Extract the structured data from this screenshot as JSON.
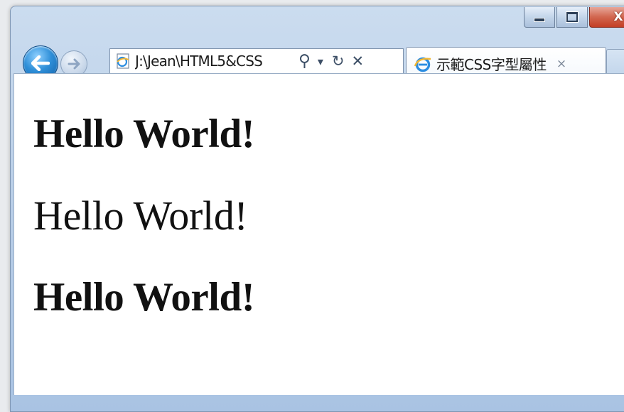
{
  "window": {
    "caption_buttons": {
      "minimize_icon": "minimize-icon",
      "maximize_icon": "maximize-icon",
      "close_glyph": "X"
    }
  },
  "toolbar": {
    "back_icon": "back-arrow-icon",
    "forward_icon": "forward-arrow-icon",
    "address": "J:\\Jean\\HTML5&CSS",
    "address_tools": {
      "search": "⚲",
      "dropdown": "▾",
      "refresh": "↻",
      "stop": "✕"
    }
  },
  "tab": {
    "title": "示範CSS字型屬性",
    "close": "×",
    "icon": "ie-icon"
  },
  "content": {
    "lines": [
      "Hello World!",
      "Hello World!",
      "Hello World!"
    ]
  },
  "colors": {
    "back_button": "#2f8fd8",
    "close_button": "#c33e24",
    "frame": "#b7cde7"
  }
}
